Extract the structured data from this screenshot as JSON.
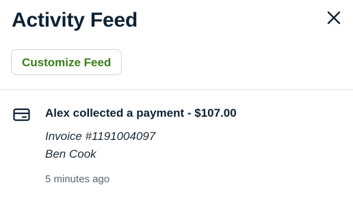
{
  "header": {
    "title": "Activity Feed",
    "close_icon": "close-icon"
  },
  "toolbar": {
    "customize_label": "Customize Feed",
    "accent_color": "#3a7d1c"
  },
  "activities": [
    {
      "icon": "credit-card-icon",
      "title": "Alex collected a payment - $107.00",
      "details": [
        "Invoice #1191004097",
        "Ben Cook"
      ],
      "time": "5 minutes ago"
    }
  ]
}
